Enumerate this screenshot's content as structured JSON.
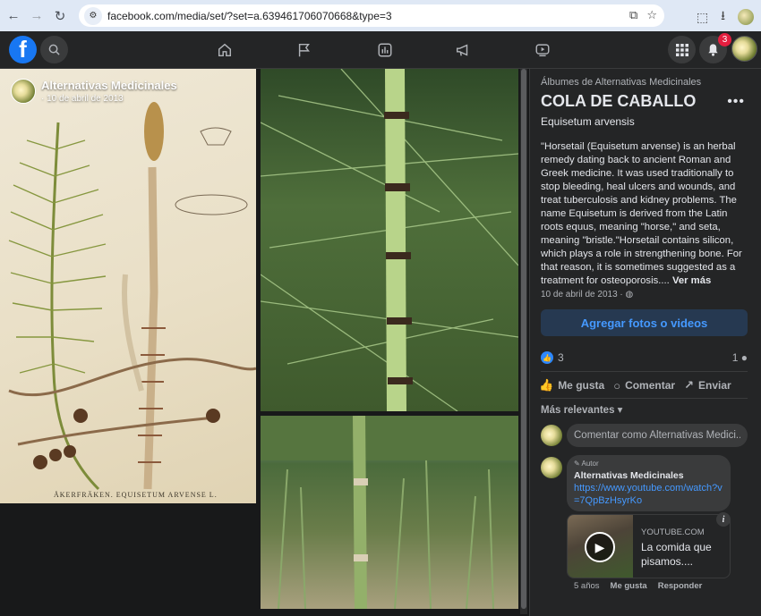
{
  "browser": {
    "url": "facebook.com/media/set/?set=a.639461706070668&type=3"
  },
  "topbar": {
    "notification_count": "3"
  },
  "photo_overlay": {
    "name": "Alternativas Medicinales",
    "date": "· 10 de abril de 2013"
  },
  "photo_caption": "ÅKERFRÄKEN. EQUISETUM ARVENSE L.",
  "panel": {
    "albums_link": "Álbumes de Alternativas Medicinales",
    "title": "COLA DE CABALLO",
    "subtitle": "Equisetum arvensis",
    "description": "\"Horsetail (Equisetum arvense) is an herbal remedy dating back to ancient Roman and Greek medicine. It was used traditionally to stop bleeding, heal ulcers and wounds, and treat tuberculosis and kidney problems. The name Equisetum is derived from the Latin roots equus, meaning \"horse,\" and seta, meaning \"bristle.\"Horsetail contains silicon, which plays a role in strengthening bone. For that reason, it is sometimes suggested as a treatment for osteoporosis....",
    "see_more": "Ver más",
    "date": "10 de abril de 2013 ·",
    "add_button": "Agregar fotos o videos",
    "like_count": "3",
    "comment_count": "1",
    "actions": {
      "like": "Me gusta",
      "comment": "Comentar",
      "share": "Enviar"
    },
    "relevance": "Más relevantes",
    "composer_placeholder": "Comentar como Alternativas Medici...",
    "comment": {
      "author_tag": "Autor",
      "name": "Alternativas Medicinales",
      "link": "https://www.youtube.com/watch?v=7QpBzHsyrKo",
      "card_source": "YOUTUBE.COM",
      "card_title": "La comida que pisamos....",
      "age": "5 años",
      "like": "Me gusta",
      "reply": "Responder"
    }
  }
}
